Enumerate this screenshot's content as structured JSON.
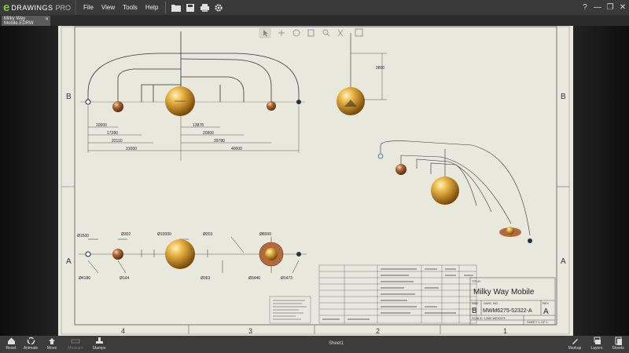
{
  "app": {
    "brand": "DRAWINGS",
    "brand_pro": "PRO"
  },
  "menu": [
    "File",
    "View",
    "Tools",
    "Help"
  ],
  "window_controls": {
    "help": "?",
    "minimize": "—",
    "restore": "❐",
    "close": "✕"
  },
  "tab": {
    "label": "Milky Way Mobile.EDRW",
    "close": "✕"
  },
  "drawing": {
    "zone_letters": {
      "top": "B",
      "bottom": "A"
    },
    "zone_numbers": [
      "4",
      "3",
      "2",
      "1"
    ],
    "dims_top": [
      "10000",
      "17280",
      "22110",
      "31000",
      "13878",
      "20900",
      "29780",
      "40000"
    ],
    "dim_vertical": "2800",
    "dims_bottom_top": [
      "Ø1500",
      "Ø302",
      "Ø10000",
      "Ø203",
      "Ø8000"
    ],
    "dims_bottom_low": [
      "Ø4180",
      "Ø144",
      "Ø363",
      "Ø3440",
      "Ø1473"
    ],
    "title_block": {
      "title_label": "TITLE:",
      "title": "Milky Way Mobile",
      "size_label": "SIZE",
      "size": "B",
      "dwg_label": "DWG. NO.",
      "dwg_no": "MWM6275-52322-A",
      "rev_label": "REV",
      "rev": "A",
      "scale": "SCALE: 1:500  WEIGHT:",
      "sheet": "SHEET 1 OF 1"
    }
  },
  "bottom": {
    "buttons": [
      {
        "label": "Reset"
      },
      {
        "label": "Animate"
      },
      {
        "label": "Move"
      },
      {
        "label": "Measure"
      },
      {
        "label": "Stamps"
      }
    ],
    "right_buttons": [
      {
        "label": "Markup"
      },
      {
        "label": "Layers"
      },
      {
        "label": "Sheets"
      }
    ],
    "sheet": "Sheet1"
  },
  "colors": {
    "accent": "#8cc63f",
    "planet": "#d99a2a",
    "paper": "#e8e8dd",
    "chrome": "#3a3a3a"
  }
}
